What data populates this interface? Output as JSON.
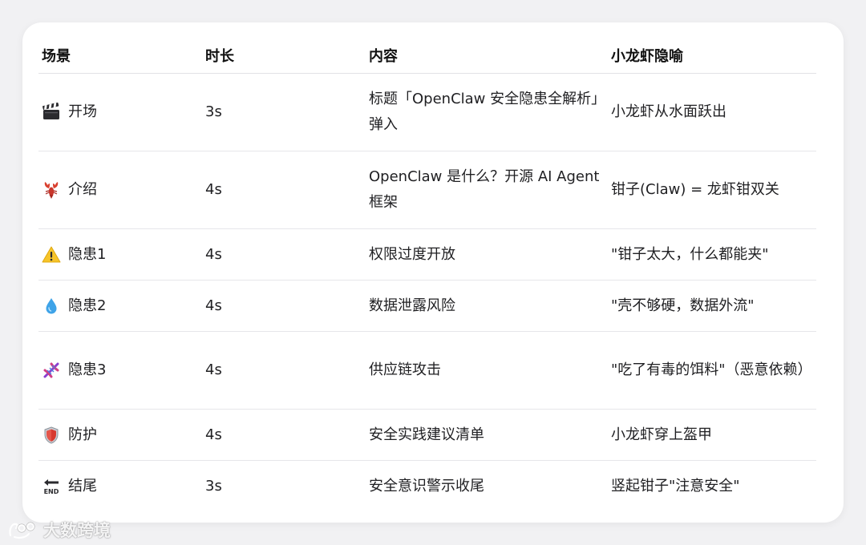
{
  "table": {
    "headers": [
      "场景",
      "时长",
      "内容",
      "小龙虾隐喻"
    ],
    "rows": [
      {
        "icon": "clapper-board-icon",
        "scene": "开场",
        "duration": "3s",
        "content": "标题「OpenClaw 安全隐患全解析」弹入",
        "metaphor": "小龙虾从水面跃出"
      },
      {
        "icon": "lobster-icon",
        "scene": "介绍",
        "duration": "4s",
        "content": "OpenClaw 是什么？开源 AI Agent 框架",
        "metaphor": "钳子(Claw) = 龙虾钳双关"
      },
      {
        "icon": "warning-icon",
        "scene": "隐患1",
        "duration": "4s",
        "content": "权限过度开放",
        "metaphor": "\"钳子太大，什么都能夹\""
      },
      {
        "icon": "droplet-icon",
        "scene": "隐患2",
        "duration": "4s",
        "content": "数据泄露风险",
        "metaphor": "\"壳不够硬，数据外流\""
      },
      {
        "icon": "dna-icon",
        "scene": "隐患3",
        "duration": "4s",
        "content": "供应链攻击",
        "metaphor": "\"吃了有毒的饵料\"（恶意依赖）"
      },
      {
        "icon": "shield-icon",
        "scene": "防护",
        "duration": "4s",
        "content": "安全实践建议清单",
        "metaphor": "小龙虾穿上盔甲"
      },
      {
        "icon": "end-arrow-icon",
        "scene": "结尾",
        "duration": "3s",
        "content": "安全意识警示收尾",
        "metaphor": "竖起钳子\"注意安全\""
      }
    ]
  },
  "watermark": {
    "text": "大数跨境",
    "icon": "brand-logo-icon"
  }
}
